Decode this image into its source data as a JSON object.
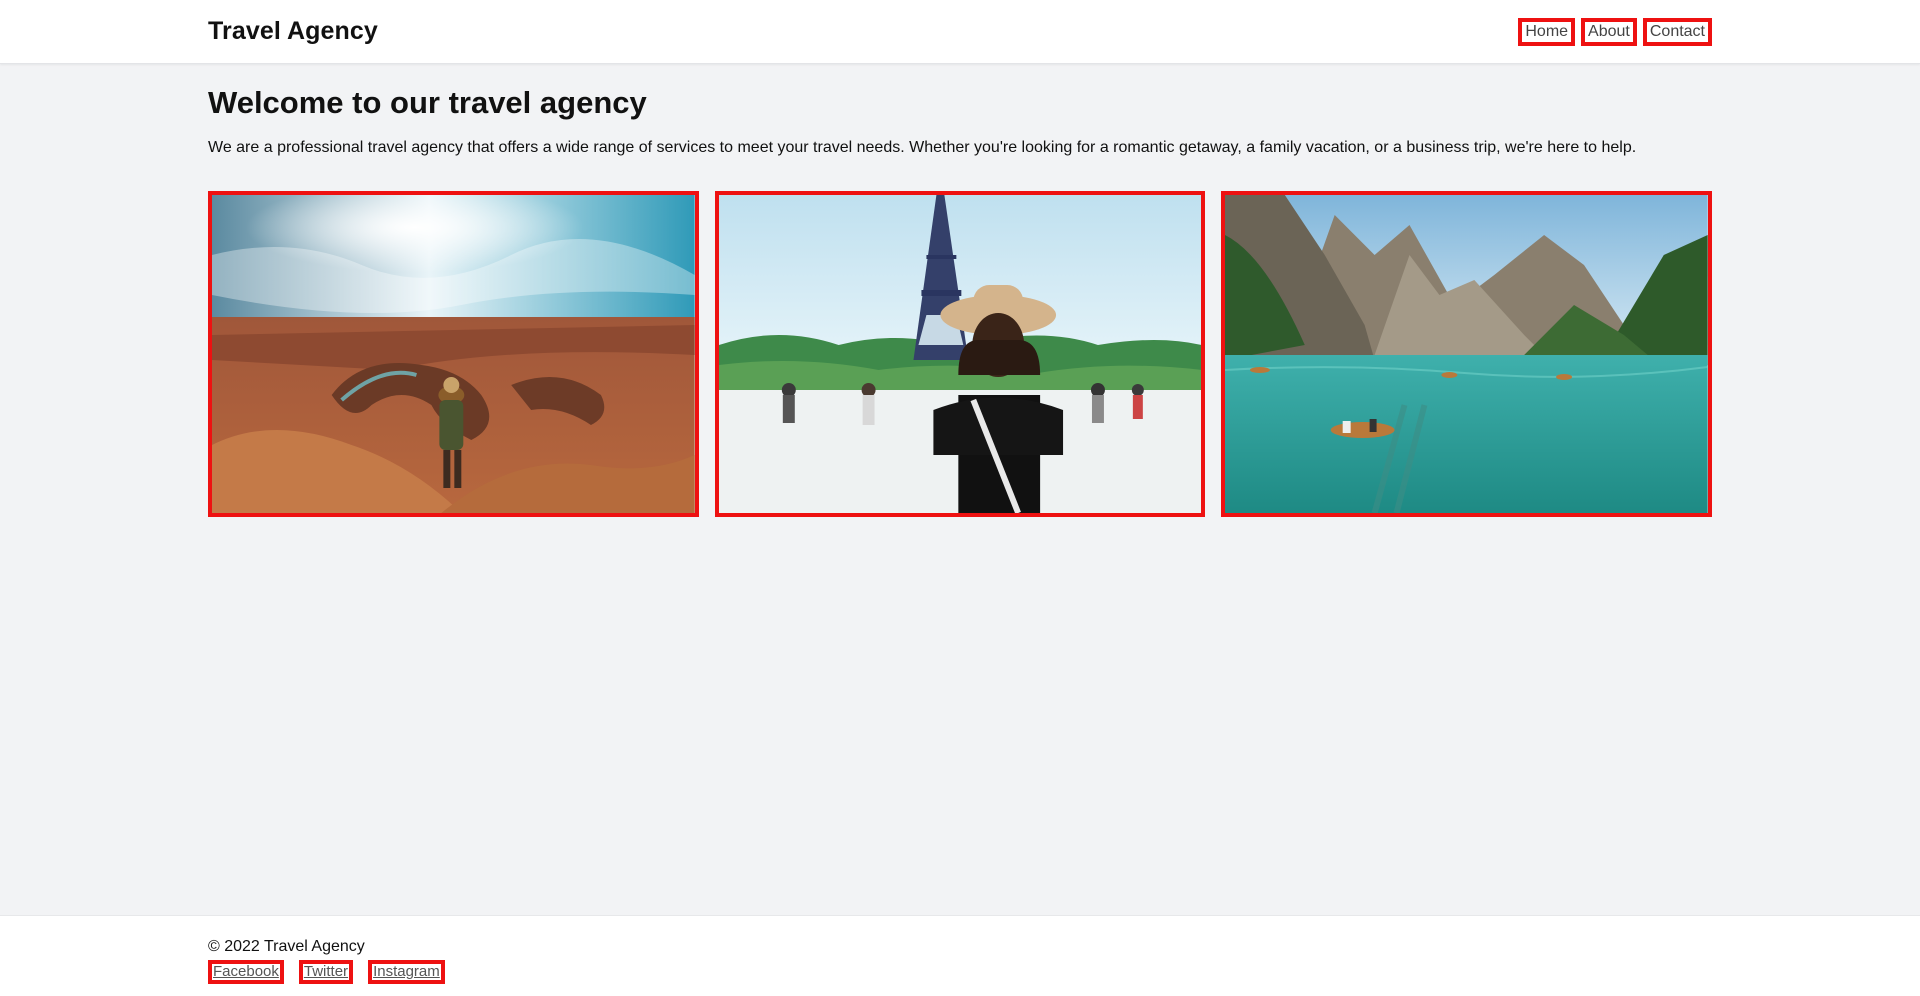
{
  "header": {
    "brand": "Travel Agency",
    "nav": [
      {
        "label": "Home"
      },
      {
        "label": "About"
      },
      {
        "label": "Contact"
      }
    ]
  },
  "main": {
    "title": "Welcome to our travel agency",
    "intro": "We are a professional travel agency that offers a wide range of services to meet your travel needs. Whether you're looking for a romantic getaway, a family vacation, or a business trip, we're here to help.",
    "gallery": [
      {
        "name": "canyon-photo"
      },
      {
        "name": "eiffel-tower-photo"
      },
      {
        "name": "mountain-lake-photo"
      }
    ]
  },
  "footer": {
    "copyright": "© 2022 Travel Agency",
    "social": [
      {
        "label": "Facebook"
      },
      {
        "label": "Twitter"
      },
      {
        "label": "Instagram"
      }
    ]
  },
  "colors": {
    "highlight_border": "#ee1111",
    "page_background": "#f2f3f5",
    "header_background": "#ffffff"
  }
}
